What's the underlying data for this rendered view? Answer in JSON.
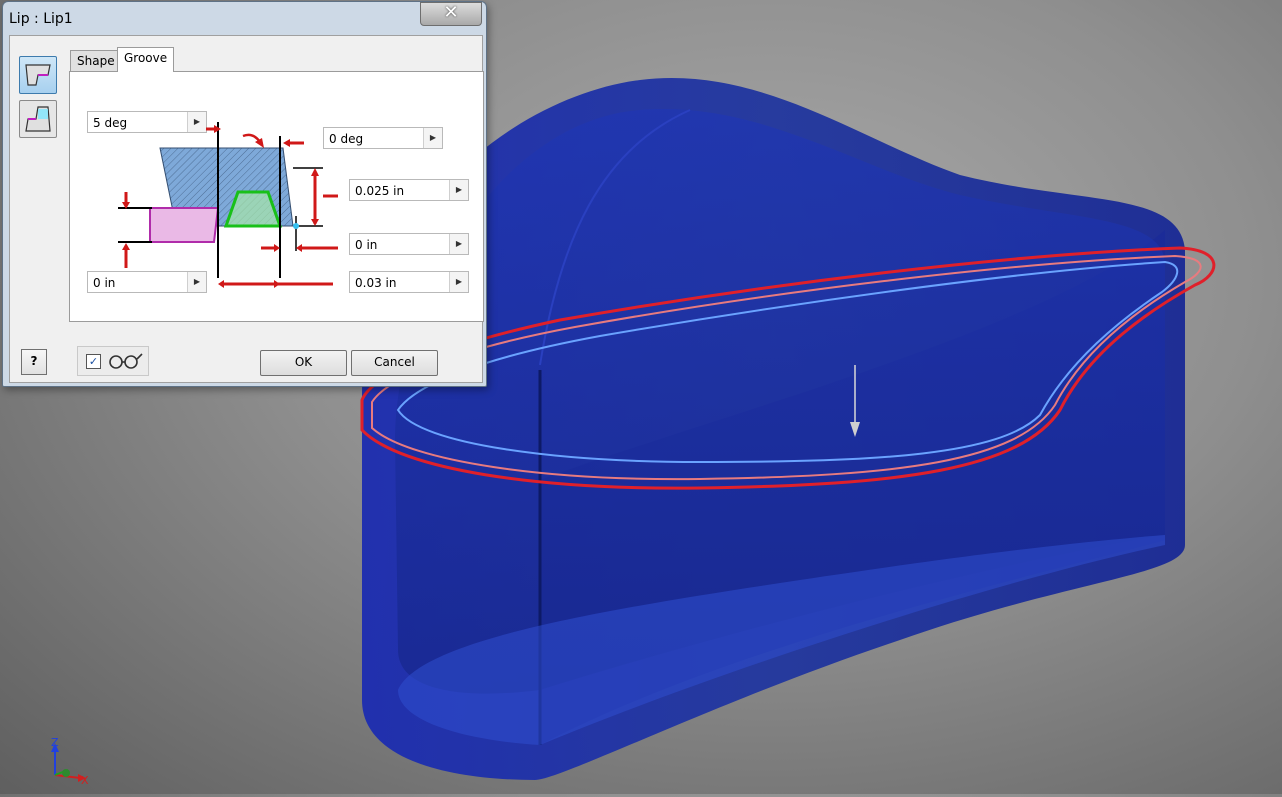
{
  "dialog": {
    "title": "Lip : Lip1",
    "close_glyph": "✕",
    "tabs": [
      {
        "label": "Shape",
        "active": false
      },
      {
        "label": "Groove",
        "active": true
      }
    ],
    "side_buttons": [
      {
        "icon": "lip-icon",
        "active": true
      },
      {
        "icon": "groove-icon",
        "active": false
      }
    ],
    "fields": {
      "draft_angle_left": "5 deg",
      "draft_angle_right": "0 deg",
      "groove_depth": "0.025 in",
      "clearance": "0 in",
      "width": "0.03 in",
      "offset": "0 in"
    },
    "spin_glyph": "▶",
    "help_glyph": "?",
    "preview_checked": true,
    "preview_check_glyph": "✓",
    "ok_label": "OK",
    "cancel_label": "Cancel"
  },
  "viewport": {
    "axis_labels": {
      "z": "Z",
      "x": "X"
    },
    "body_color": "#1a2fa8",
    "lip_outline_color": "#e0202a",
    "groove_outline_color": "#6aa3ff"
  }
}
